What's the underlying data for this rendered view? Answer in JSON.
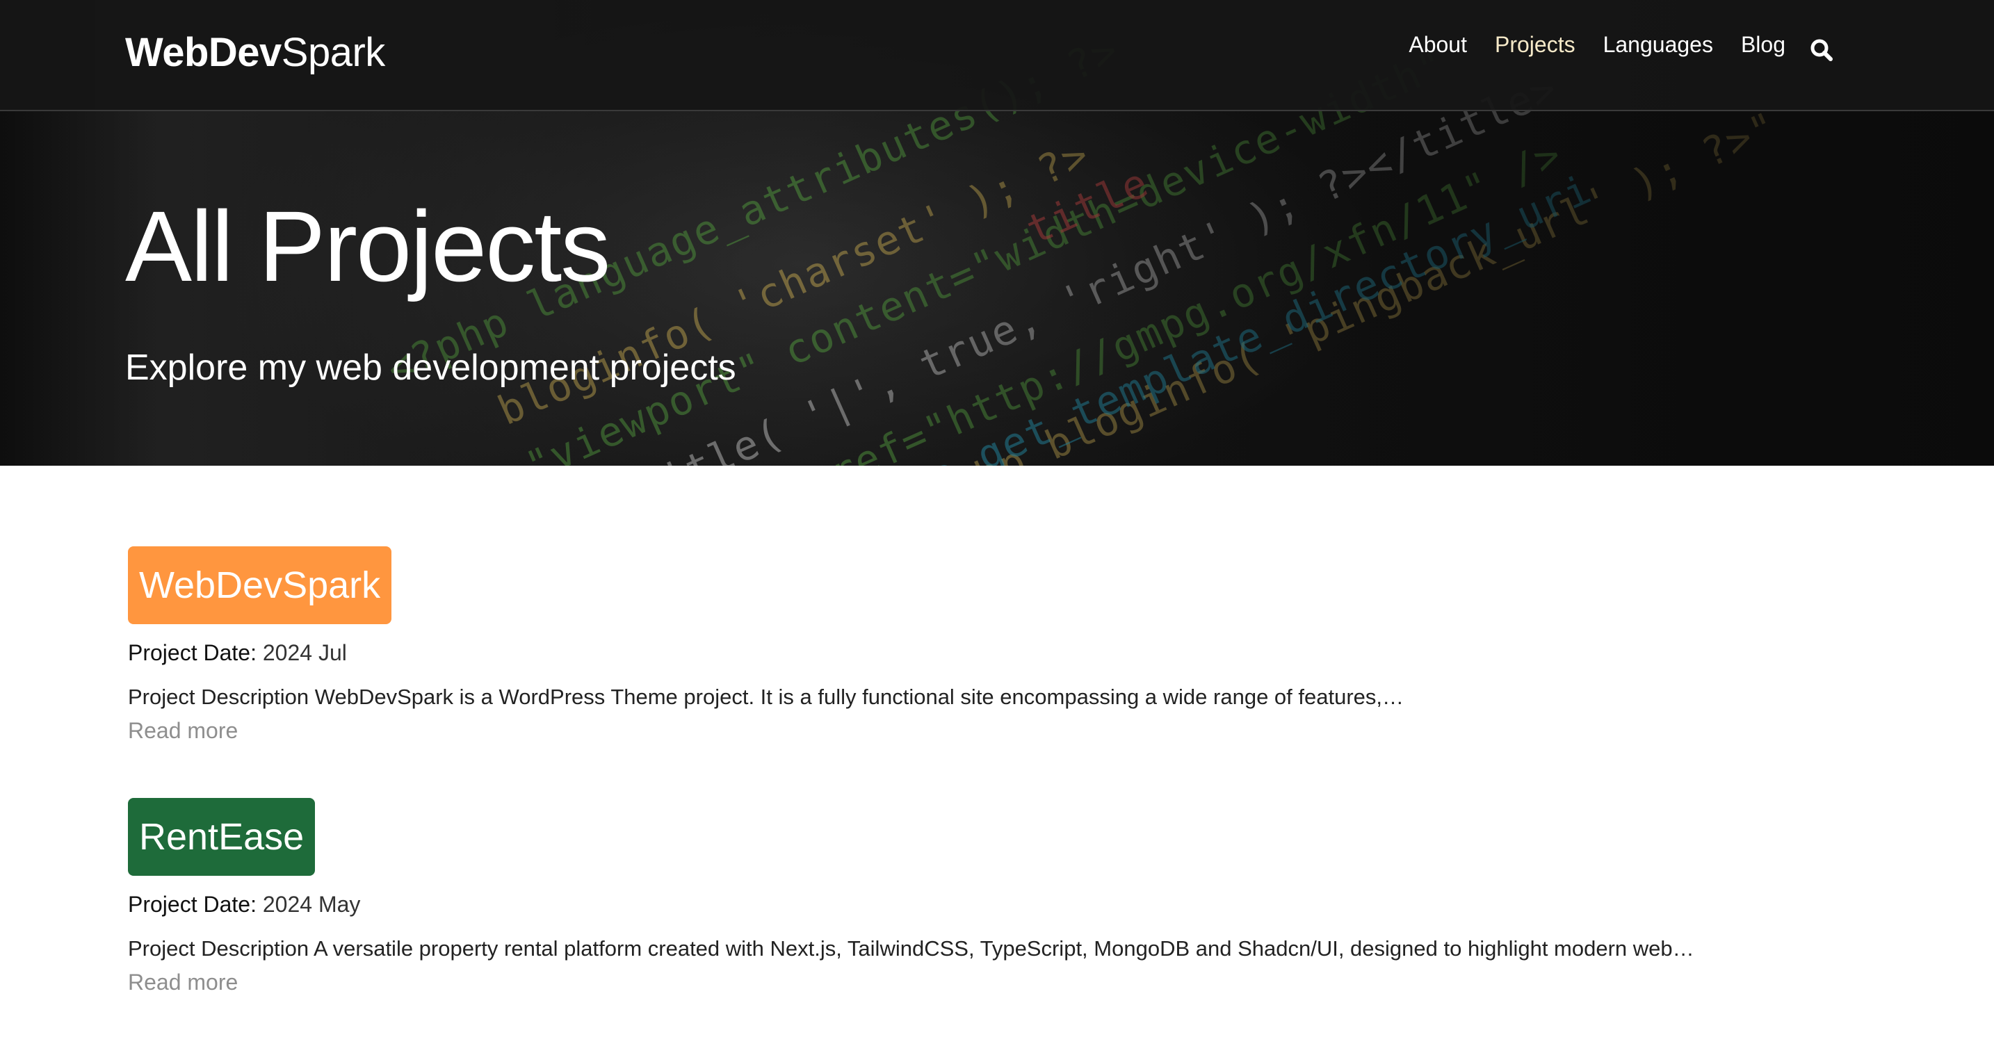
{
  "header": {
    "logo_bold": "WebDev",
    "logo_light": "Spark",
    "nav": [
      {
        "label": "About"
      },
      {
        "label": "Projects"
      },
      {
        "label": "Languages"
      },
      {
        "label": "Blog"
      }
    ],
    "search_icon": "search-icon"
  },
  "hero": {
    "title": "All Projects",
    "subtitle": "Explore my web development projects"
  },
  "projects": [
    {
      "badge": "WebDevSpark",
      "badge_color": "#ff963f",
      "date_label": "Project Date:",
      "date_value": "2024 Jul",
      "description": "Project Description WebDevSpark is a WordPress Theme project. It is a fully functional site encompassing a wide range of features,…",
      "read_more": "Read more"
    },
    {
      "badge": "RentEase",
      "badge_color": "#1e6b3a",
      "date_label": "Project Date:",
      "date_value": "2024 May",
      "description": "Project Description A versatile property rental platform created with Next.js, TailwindCSS, TypeScript, MongoDB and Shadcn/UI, designed to highlight modern web…",
      "read_more": "Read more"
    }
  ]
}
